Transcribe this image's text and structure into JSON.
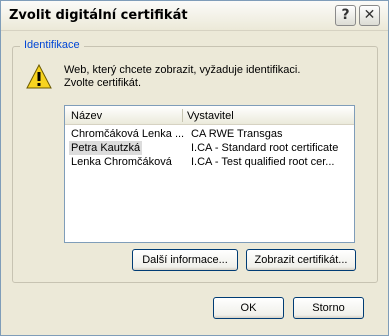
{
  "window": {
    "title": "Zvolit digitální certifikát",
    "help_button": "?",
    "close_button": "✕"
  },
  "group": {
    "title": "Identifikace",
    "message_line1": "Web, který chcete zobrazit, vyžaduje identifikaci.",
    "message_line2": "Zvolte certifikát."
  },
  "list": {
    "columns": [
      "Název",
      "Vystavitel"
    ],
    "rows": [
      {
        "name": "Chromčáková Lenka ...",
        "issuer": "CA RWE Transgas",
        "selected": false
      },
      {
        "name": "Petra Kautzká",
        "issuer": "I.CA - Standard root certificate",
        "selected": true
      },
      {
        "name": "Lenka Chromčáková",
        "issuer": "I.CA - Test qualified root cer...",
        "selected": false
      }
    ]
  },
  "buttons": {
    "more_info": "Další informace...",
    "show_cert": "Zobrazit certifikát...",
    "ok": "OK",
    "cancel": "Storno"
  }
}
